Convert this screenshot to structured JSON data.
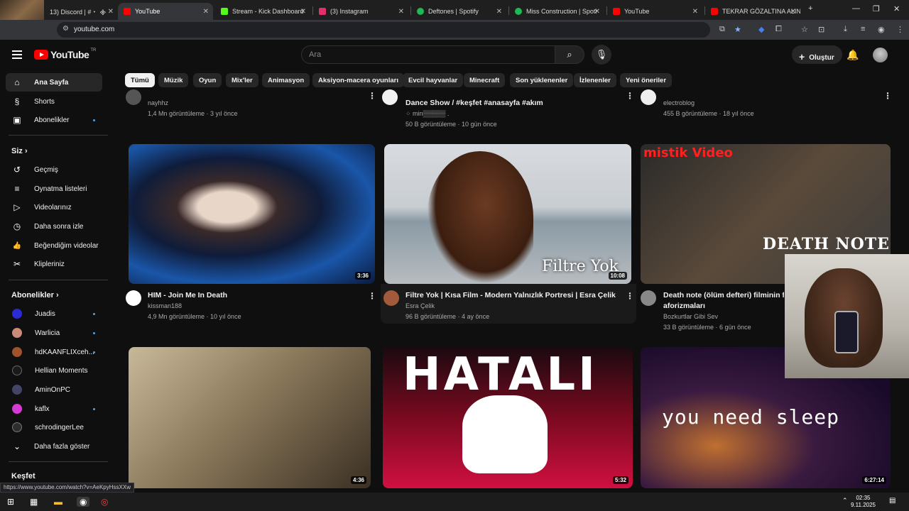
{
  "browser": {
    "tabs": [
      {
        "label": "13) Discord | #・ ᯽ ·",
        "color": "#5865f2"
      },
      {
        "label": "YouTube",
        "color": "#ff0000",
        "active": true
      },
      {
        "label": "Stream - Kick Dashboard",
        "color": "#53fc18"
      },
      {
        "label": "(3) Instagram",
        "color": "#e1306c"
      },
      {
        "label": "Deftones | Spotify",
        "color": "#1db954"
      },
      {
        "label": "Miss Construction | Spoti",
        "color": "#1db954"
      },
      {
        "label": "YouTube",
        "color": "#ff0000"
      },
      {
        "label": "TEKRAR GÖZALTINA ALIN",
        "color": "#ff0000"
      }
    ],
    "new_tab": "+",
    "url": "youtube.com",
    "status_url": "https://www.youtube.com/watch?v=AeKpyHssXXw"
  },
  "header": {
    "logo": "YouTube",
    "country": "TR",
    "search_placeholder": "Ara",
    "create_label": "Oluştur"
  },
  "sidebar": {
    "main": [
      {
        "label": "Ana Sayfa",
        "icon": "⌂",
        "active": true
      },
      {
        "label": "Shorts",
        "icon": "§"
      },
      {
        "label": "Abonelikler",
        "icon": "▣",
        "dot": true
      }
    ],
    "you_heading": "Siz",
    "you_items": [
      {
        "label": "Geçmiş",
        "icon": "↺"
      },
      {
        "label": "Oynatma listeleri",
        "icon": "≡"
      },
      {
        "label": "Videolarınız",
        "icon": "▷"
      },
      {
        "label": "Daha sonra izle",
        "icon": "◷"
      },
      {
        "label": "Beğendiğim videolar",
        "icon": "👍"
      },
      {
        "label": "Klipleriniz",
        "icon": "✂"
      }
    ],
    "subs_heading": "Abonelikler",
    "subs": [
      {
        "label": "Juadis",
        "color": "#2b2bd6",
        "dot": true
      },
      {
        "label": "Warlicia",
        "color": "#c98a7a",
        "dot": true
      },
      {
        "label": "hdKAANFLIXceh...",
        "color": "#a0522d",
        "dot": true
      },
      {
        "label": "Hellian Moments",
        "color": "#1a1a1a"
      },
      {
        "label": "AminOnPC",
        "color": "#444466"
      },
      {
        "label": "kaflx",
        "color": "#d63ad6",
        "dot": true
      },
      {
        "label": "schrodingerLee",
        "color": "#2e2e2e"
      }
    ],
    "show_more": "Daha fazla göster",
    "explore_heading": "Keşfet"
  },
  "chips": [
    "Tümü",
    "Müzik",
    "Oyun",
    "Mix'ler",
    "Animasyon",
    "Aksiyon-macera oyunları",
    "Evcil hayvanlar",
    "Minecraft",
    "Son yüklenenler",
    "İzlenenler",
    "Yeni öneriler"
  ],
  "top_row": [
    {
      "channel": "nayhhz",
      "meta": "1,4 Mn görüntüleme · 3 yıl önce"
    },
    {
      "title": "Dance Show / #keşfet #anasayfa #akım",
      "channel": "⁘ min▒▒▒▒▒ .",
      "meta": "50 B görüntüleme · 10 gün önce"
    },
    {
      "channel": "electroblog",
      "meta": "455 B görüntüleme · 18 yıl önce"
    }
  ],
  "videos": [
    {
      "title": "HIM - Join Me In Death",
      "channel": "kissman188",
      "meta": "4,9 Mn görüntüleme · 10 yıl önce",
      "duration": "3:36"
    },
    {
      "title": "Filtre Yok | Kısa Film - Modern Yalnızlık Portresi | Esra Çelik",
      "channel": "Esra Çelik",
      "meta": "96 B görüntüleme · 4 ay önce",
      "duration": "10:08",
      "overlay": "Filtre Yok"
    },
    {
      "title": "Death note (ölüm defteri) filminin fel",
      "title2": "aforizmaları",
      "channel": "Bozkurtlar Gibi Sev",
      "meta": "33 B görüntüleme · 6 gün önce",
      "overlay": "mistik Video",
      "overlay2": "DEATH NOTE"
    },
    {
      "duration": "4:36"
    },
    {
      "duration": "5:32",
      "overlay": "HATALI"
    },
    {
      "duration": "6:27:14",
      "overlay": "you need sleep"
    }
  ],
  "taskbar": {
    "time": "02:35",
    "date": "9.11.2025"
  }
}
